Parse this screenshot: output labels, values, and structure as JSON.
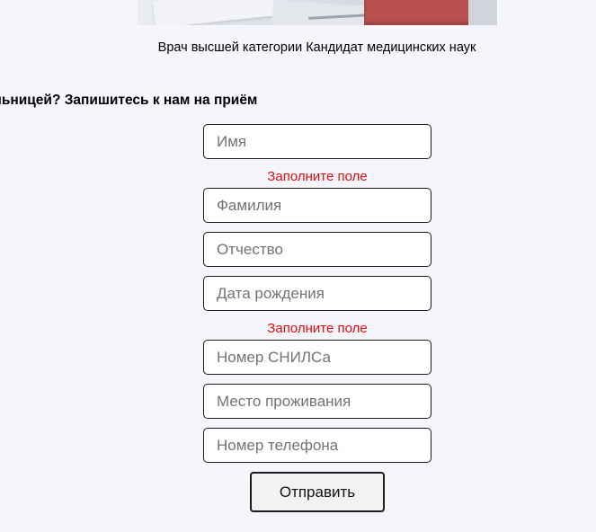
{
  "doctor": {
    "caption": "Врач высшей категории Кандидат медицинских наук"
  },
  "signup": {
    "heading": "льницей? Запишитесь к нам на приём"
  },
  "form": {
    "fields": [
      {
        "placeholder": "Имя",
        "value": ""
      },
      {
        "placeholder": "Фамилия",
        "value": ""
      },
      {
        "placeholder": "Отчество",
        "value": ""
      },
      {
        "placeholder": "Дата рождения",
        "value": ""
      },
      {
        "placeholder": "Номер СНИЛСа",
        "value": ""
      },
      {
        "placeholder": "Место проживания",
        "value": ""
      },
      {
        "placeholder": "Номер телефона",
        "value": ""
      }
    ],
    "errors": {
      "first_name": "Заполните поле",
      "birth_date": "Заполните поле"
    },
    "submit_label": "Отправить"
  },
  "colors": {
    "background": "#f7f5fc",
    "error": "#e10d0d",
    "border": "#1b1b1b"
  }
}
